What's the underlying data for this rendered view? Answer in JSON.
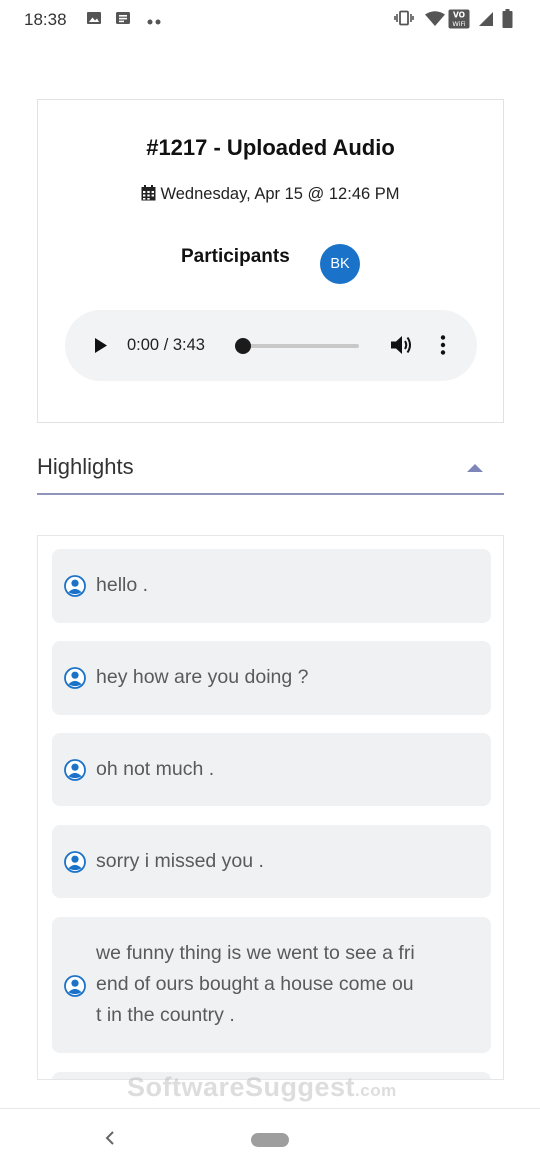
{
  "status_bar": {
    "time": "18:38",
    "icons": [
      "image-icon",
      "news-icon",
      "more-dots-icon",
      "vibrate-icon",
      "wifi-icon",
      "vowifi-icon",
      "signal-icon",
      "battery-icon"
    ],
    "vowifi_label_top": "VO",
    "vowifi_label_bottom": "WiFi"
  },
  "meeting": {
    "title": "#1217 - Uploaded Audio",
    "date": "Wednesday, Apr 15 @ 12:46 PM",
    "participants_label": "Participants",
    "participants": [
      {
        "initials": "BK",
        "color": "#1a73c9"
      }
    ]
  },
  "audio_player": {
    "time": "0:00 / 3:43",
    "progress": 0.0
  },
  "highlights": {
    "title": "Highlights",
    "expanded": true,
    "accent": "#8f94b8",
    "items": [
      {
        "text": "hello ."
      },
      {
        "text": "hey how are you doing ?"
      },
      {
        "text": "oh not much ."
      },
      {
        "text": "sorry i missed you ."
      },
      {
        "text": "we funny thing is we went to see a friend of ours bought a house come out in the country ."
      }
    ]
  },
  "watermark": {
    "text": "SoftwareSuggest",
    "suffix": ".com"
  },
  "colors": {
    "avatar": "#1a73c9",
    "card_bg": "#f0f1f2",
    "player_bg": "#f1f3f4"
  }
}
